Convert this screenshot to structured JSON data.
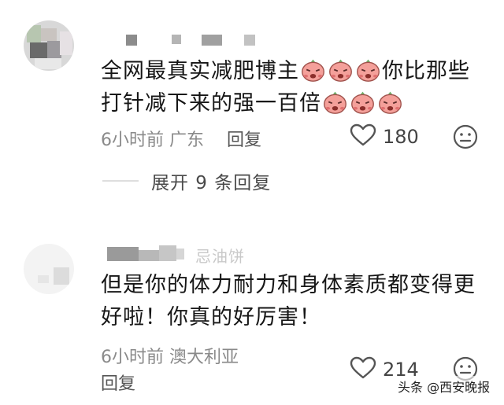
{
  "comments": [
    {
      "username_tail": "",
      "text_line1": "全网最真实减肥博主",
      "text_line1_after": "你比那些",
      "text_line2": "打针减下来的强一百倍",
      "emoji_name": "crying-peach-emoji",
      "time": "6小时前",
      "location": "广东",
      "reply": "回复",
      "likes": "180"
    },
    {
      "username_tail": "忌油饼",
      "text_line1": "但是你的体力耐力和身体素质都变得更",
      "text_line2": "好啦！你真的好厉害！",
      "time": "6小时前",
      "location": "澳大利亚",
      "reply": "回复",
      "likes": "214"
    }
  ],
  "expand_replies": "展开 9 条回复",
  "watermark": "头条 @西安晚报",
  "colors": {
    "text": "#161616",
    "meta": "#8a8a8a",
    "emoji": "#f4a09a"
  }
}
